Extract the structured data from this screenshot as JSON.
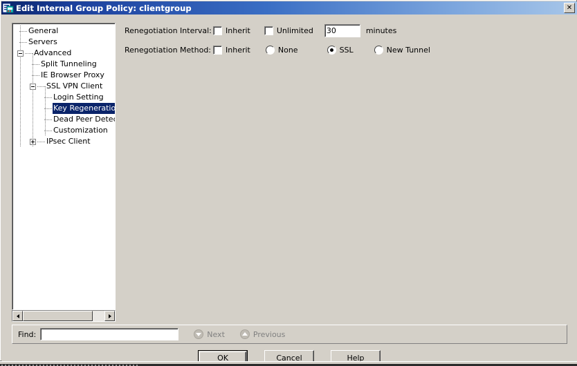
{
  "window": {
    "title": "Edit Internal Group Policy: clientgroup",
    "icon": "app-policy-icon",
    "close_label": "✕"
  },
  "colors": {
    "title_gradient_start": "#0a246a",
    "title_gradient_end": "#a7c6e9",
    "face": "#d4d0c8",
    "selection": "#0a246a",
    "selection_text": "#ffffff",
    "disabled_text": "#808080"
  },
  "tree": {
    "nodes": [
      {
        "label": "General",
        "level": 1,
        "toggle": "none",
        "selected": false
      },
      {
        "label": "Servers",
        "level": 1,
        "toggle": "none",
        "selected": false
      },
      {
        "label": "Advanced",
        "level": 1,
        "toggle": "minus",
        "selected": false
      },
      {
        "label": "Split Tunneling",
        "level": 2,
        "toggle": "none",
        "selected": false
      },
      {
        "label": "IE Browser Proxy",
        "level": 2,
        "toggle": "none",
        "selected": false
      },
      {
        "label": "SSL VPN Client",
        "level": 2,
        "toggle": "minus",
        "selected": false
      },
      {
        "label": "Login Setting",
        "level": 3,
        "toggle": "none",
        "selected": false
      },
      {
        "label": "Key Regeneration",
        "level": 3,
        "toggle": "none",
        "selected": true
      },
      {
        "label": "Dead Peer Detection",
        "level": 3,
        "toggle": "none",
        "selected": false
      },
      {
        "label": "Customization",
        "level": 3,
        "toggle": "none",
        "selected": false
      },
      {
        "label": "IPsec Client",
        "level": 2,
        "toggle": "plus",
        "selected": false
      }
    ],
    "scrollbar": {
      "left_arrow": "scroll-left-icon",
      "right_arrow": "scroll-right-icon"
    }
  },
  "form": {
    "interval": {
      "label": "Renegotiation Interval:",
      "inherit_label": "Inherit",
      "inherit_checked": false,
      "unlimited_label": "Unlimited",
      "unlimited_checked": false,
      "value": "30",
      "placeholder": "",
      "unit_label": "minutes"
    },
    "method": {
      "label": "Renegotiation Method:",
      "inherit_label": "Inherit",
      "inherit_checked": false,
      "options": [
        {
          "label": "None",
          "selected": false
        },
        {
          "label": "SSL",
          "selected": true
        },
        {
          "label": "New Tunnel",
          "selected": false
        }
      ]
    }
  },
  "findbar": {
    "label": "Find:",
    "value": "",
    "placeholder": "",
    "next_label": "Next",
    "previous_label": "Previous",
    "next_enabled": false,
    "previous_enabled": false
  },
  "buttons": [
    {
      "label": "OK",
      "default": true
    },
    {
      "label": "Cancel",
      "default": false
    },
    {
      "label": "Help",
      "default": false
    }
  ]
}
